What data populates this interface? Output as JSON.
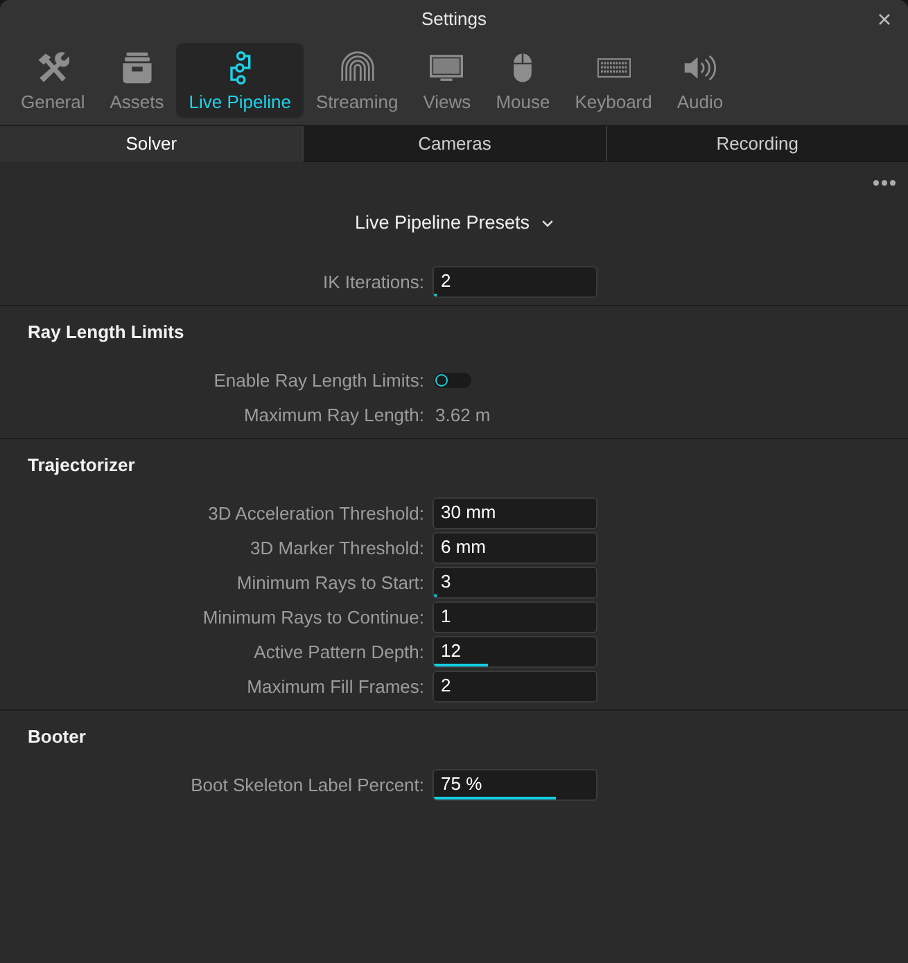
{
  "window": {
    "title": "Settings"
  },
  "categories": [
    {
      "label": "General",
      "selected": false
    },
    {
      "label": "Assets",
      "selected": false
    },
    {
      "label": "Live Pipeline",
      "selected": true
    },
    {
      "label": "Streaming",
      "selected": false
    },
    {
      "label": "Views",
      "selected": false
    },
    {
      "label": "Mouse",
      "selected": false
    },
    {
      "label": "Keyboard",
      "selected": false
    },
    {
      "label": "Audio",
      "selected": false
    }
  ],
  "subtabs": [
    {
      "label": "Solver",
      "selected": true
    },
    {
      "label": "Cameras",
      "selected": false
    },
    {
      "label": "Recording",
      "selected": false
    }
  ],
  "presets_menu": {
    "label": "Live Pipeline Presets"
  },
  "sections": [
    {
      "rows": [
        {
          "kind": "field",
          "label": "IK Iterations:",
          "value": "2",
          "level": 0.02
        }
      ]
    },
    {
      "title": "Ray Length Limits",
      "rows": [
        {
          "kind": "toggle",
          "label": "Enable Ray Length Limits:",
          "on": false
        },
        {
          "kind": "readout",
          "label": "Maximum Ray Length:",
          "value": "3.62 m"
        }
      ]
    },
    {
      "title": "Trajectorizer",
      "rows": [
        {
          "kind": "field",
          "label": "3D Acceleration Threshold:",
          "value": "30 mm"
        },
        {
          "kind": "field",
          "label": "3D Marker Threshold:",
          "value": "6 mm"
        },
        {
          "kind": "field",
          "label": "Minimum Rays to Start:",
          "value": "3",
          "level": 0.02
        },
        {
          "kind": "field",
          "label": "Minimum Rays to Continue:",
          "value": "1"
        },
        {
          "kind": "field",
          "label": "Active Pattern Depth:",
          "value": "12",
          "level": 0.33
        },
        {
          "kind": "field",
          "label": "Maximum Fill Frames:",
          "value": "2"
        }
      ]
    },
    {
      "title": "Booter",
      "rows": [
        {
          "kind": "field",
          "label": "Boot Skeleton Label Percent:",
          "value": "75 %",
          "level": 0.75
        }
      ]
    }
  ]
}
